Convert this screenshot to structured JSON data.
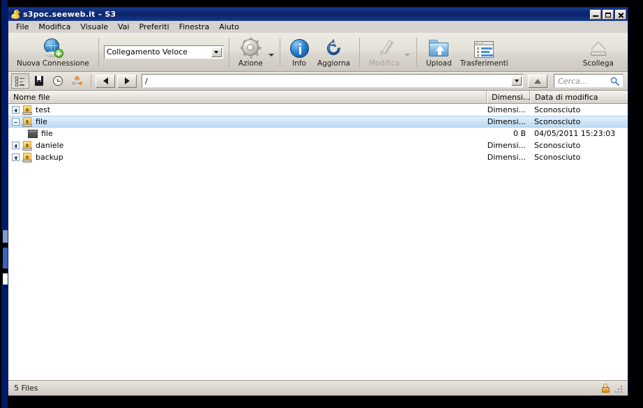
{
  "window": {
    "title": "s3poc.seeweb.it – S3",
    "app_icon": "duck-icon",
    "minimize_label": "_",
    "maximize_label": "□",
    "close_label": "×"
  },
  "menubar": {
    "items": [
      {
        "label": "File"
      },
      {
        "label": "Modifica"
      },
      {
        "label": "Visuale"
      },
      {
        "label": "Vai"
      },
      {
        "label": "Preferiti"
      },
      {
        "label": "Finestra"
      },
      {
        "label": "Aiuto"
      }
    ]
  },
  "toolbar": {
    "new_connection": {
      "label": "Nuova Connessione",
      "icon": "globe-plus-icon"
    },
    "connection_select": {
      "value": "Collegamento Veloce"
    },
    "action": {
      "label": "Azione",
      "icon": "gear-icon"
    },
    "info": {
      "label": "Info",
      "icon": "info-circle-icon"
    },
    "refresh": {
      "label": "Aggiorna",
      "icon": "refresh-arrow-icon"
    },
    "edit": {
      "label": "Modifica",
      "icon": "pencil-icon",
      "disabled": true
    },
    "upload": {
      "label": "Upload",
      "icon": "folder-upload-icon"
    },
    "transfers": {
      "label": "Trasferimenti",
      "icon": "transfers-window-icon"
    },
    "disconnect": {
      "label": "Scollega",
      "icon": "eject-icon"
    }
  },
  "navbar": {
    "view_tree": {
      "icon": "outline-tree-icon"
    },
    "bookmarks": {
      "icon": "bookmark-book-icon"
    },
    "history": {
      "icon": "clock-icon"
    },
    "bonjour": {
      "icon": "network-nodes-icon"
    },
    "back": {
      "icon": "arrow-left-icon"
    },
    "forward": {
      "icon": "arrow-right-icon"
    },
    "path": {
      "value": "/"
    },
    "up": {
      "icon": "arrow-up-icon"
    },
    "search": {
      "placeholder": "Cerca...",
      "value": "",
      "icon": "search-icon"
    }
  },
  "filelist": {
    "columns": [
      {
        "key": "name",
        "label": "Nome file"
      },
      {
        "key": "size",
        "label": "Dimensi..."
      },
      {
        "key": "modified",
        "label": "Data di modifica"
      }
    ],
    "rows": [
      {
        "name": "test",
        "size": "Dimensi...",
        "modified": "Sconosciuto",
        "icon": "bucket-icon",
        "expander": "plus",
        "indent": 0,
        "selected": false
      },
      {
        "name": "file",
        "size": "Dimensi...",
        "modified": "Sconosciuto",
        "icon": "bucket-icon",
        "expander": "minus",
        "indent": 0,
        "selected": true
      },
      {
        "name": "file",
        "size": "0 B",
        "modified": "04/05/2011 15:23:03",
        "icon": "file-icon",
        "expander": "none",
        "indent": 1,
        "selected": false
      },
      {
        "name": "daniele",
        "size": "Dimensi...",
        "modified": "Sconosciuto",
        "icon": "bucket-icon",
        "expander": "plus",
        "indent": 0,
        "selected": false
      },
      {
        "name": "backup",
        "size": "Dimensi...",
        "modified": "Sconosciuto",
        "icon": "bucket-icon",
        "expander": "plus",
        "indent": 0,
        "selected": false
      }
    ]
  },
  "statusbar": {
    "count_text": "5 Files",
    "security_icon": "padlock-icon",
    "resize_grip": "resize-grip-icon"
  },
  "colors": {
    "titlebar": "#0a246a",
    "chrome": "#d6d3ce",
    "selection": "#cfe4f7",
    "accent_blue": "#2a7fd0",
    "bucket_yellow": "#eeb93a",
    "lock_orange": "#d8881a"
  }
}
